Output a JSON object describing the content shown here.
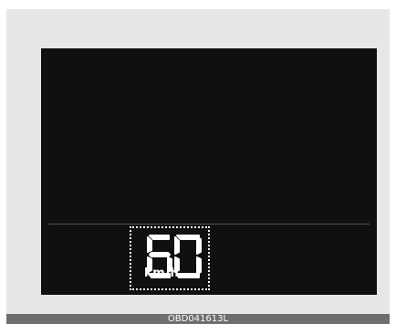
{
  "display": {
    "speed_value": "60",
    "speed_unit": "km/h"
  },
  "caption": {
    "code": "OBD041613L"
  },
  "colors": {
    "screen": "#101010",
    "panel": "#e7e7e7",
    "digit": "#ffffff",
    "footer": "#6e6e6e"
  }
}
